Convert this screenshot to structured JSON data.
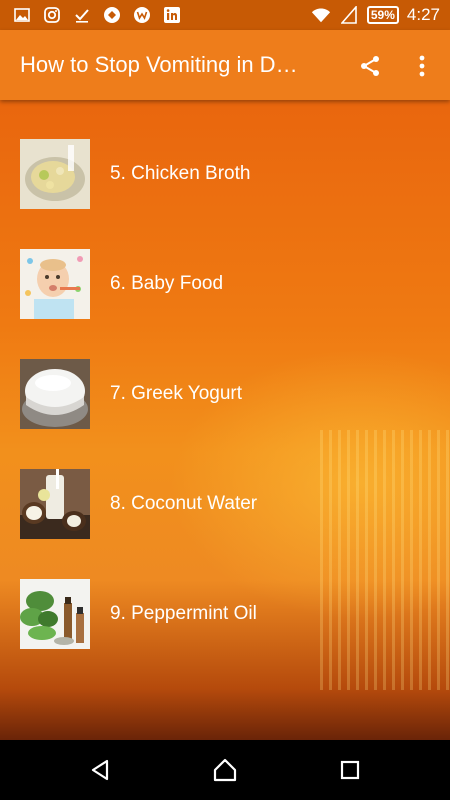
{
  "status_bar": {
    "battery": "59%",
    "time": "4:27",
    "icons": [
      "gallery-icon",
      "instagram-icon",
      "checkmark-icon",
      "app-icon",
      "circle-w-icon",
      "linkedin-icon",
      "wifi-icon",
      "no-sim-icon",
      "battery-icon"
    ]
  },
  "app_bar": {
    "title": "How to Stop Vomiting in D…",
    "actions": [
      "share-icon",
      "more-options-icon"
    ]
  },
  "list": {
    "items": [
      {
        "label": "5. Chicken Broth"
      },
      {
        "label": "6. Baby Food"
      },
      {
        "label": "7. Greek Yogurt"
      },
      {
        "label": "8. Coconut Water"
      },
      {
        "label": "9. Peppermint Oil"
      }
    ]
  },
  "nav_bar": {
    "buttons": [
      "back-icon",
      "home-icon",
      "recents-icon"
    ]
  }
}
